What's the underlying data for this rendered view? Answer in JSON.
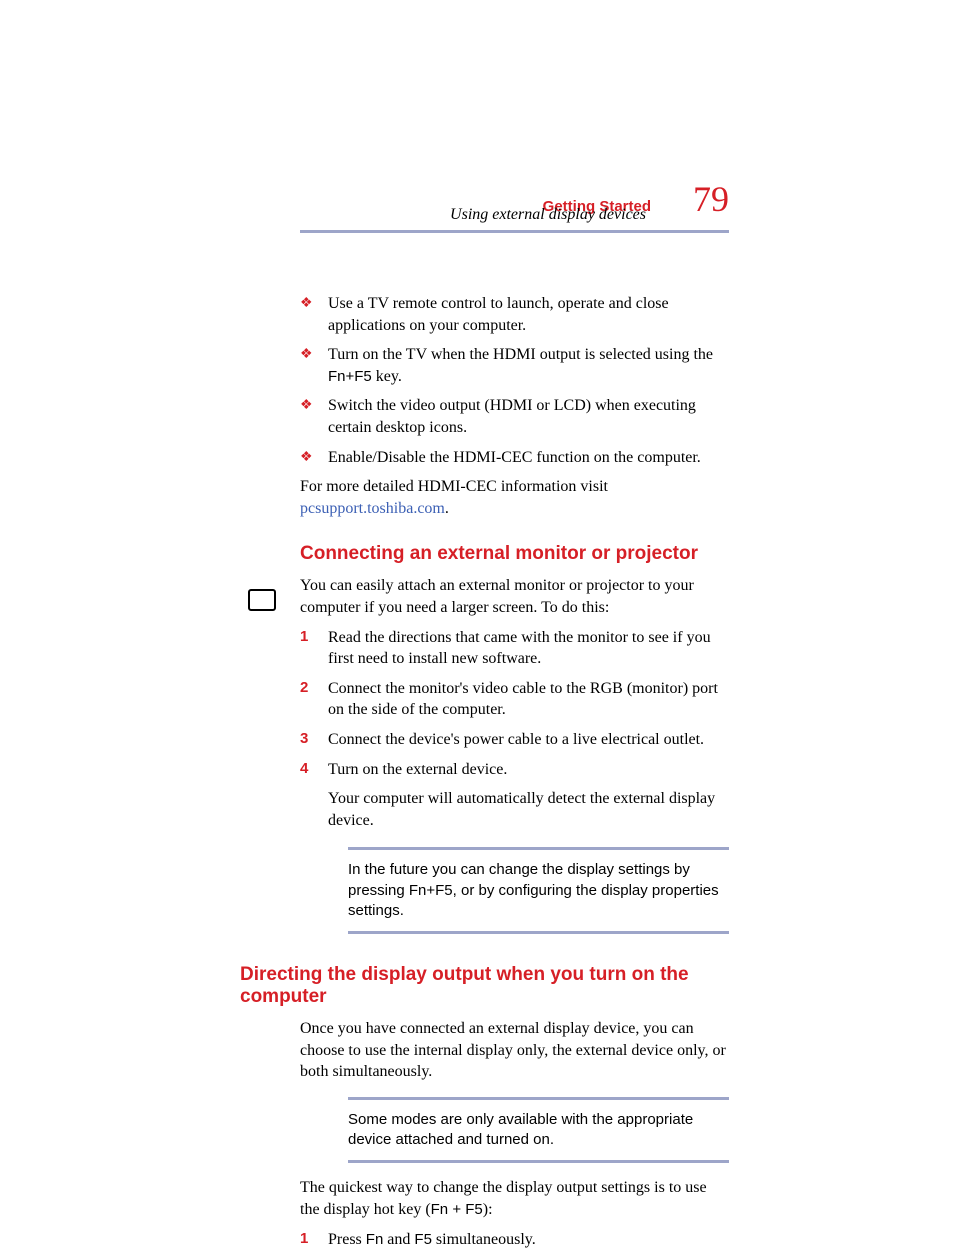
{
  "header": {
    "chapter": "Getting Started",
    "section": "Using external display devices",
    "page_number": "79"
  },
  "bullets": [
    {
      "pre": "Use a TV remote control to launch, operate and close applications on your computer."
    },
    {
      "pre": "Turn on the TV when the HDMI output is selected using the ",
      "mono": "Fn+F5",
      "post": " key."
    },
    {
      "pre": "Switch the video output (HDMI or LCD) when executing certain desktop icons."
    },
    {
      "pre": "Enable/Disable the HDMI-CEC function on the computer."
    }
  ],
  "more_info": {
    "text": "For more detailed HDMI-CEC information visit ",
    "link": "pcsupport.toshiba.com",
    "suffix": "."
  },
  "section1": {
    "title": "Connecting an external monitor or projector",
    "intro": "You can easily attach an external monitor or projector to your computer if you need a larger screen. To do this:",
    "steps": [
      "Read the directions that came with the monitor to see if you first need to install new software.",
      "Connect the monitor's video cable to the RGB (monitor) port on the side of the computer.",
      "Connect the device's power cable to a live electrical outlet.",
      "Turn on the external device."
    ],
    "after_step": "Your computer will automatically detect the external display device.",
    "note_pre": "In the future you can change the display settings by pressing ",
    "note_mono": "Fn+F5",
    "note_post": ", or by configuring the display properties settings."
  },
  "section2": {
    "title": "Directing the display output when you turn on the computer",
    "intro": "Once you have connected an external display device, you can choose to use the internal display only, the external device only, or both simultaneously.",
    "note": "Some modes are only available with the appropriate device attached and turned on.",
    "para2_pre": "The quickest way to change the display output settings is to use the display hot key (",
    "para2_mono": "Fn + F5",
    "para2_post": "):",
    "steps": [
      {
        "pre": "Press ",
        "mono1": "Fn",
        "mid": " and ",
        "mono2": "F5",
        "post": " simultaneously."
      }
    ]
  },
  "nums": [
    "1",
    "2",
    "3",
    "4"
  ],
  "n1": "1"
}
